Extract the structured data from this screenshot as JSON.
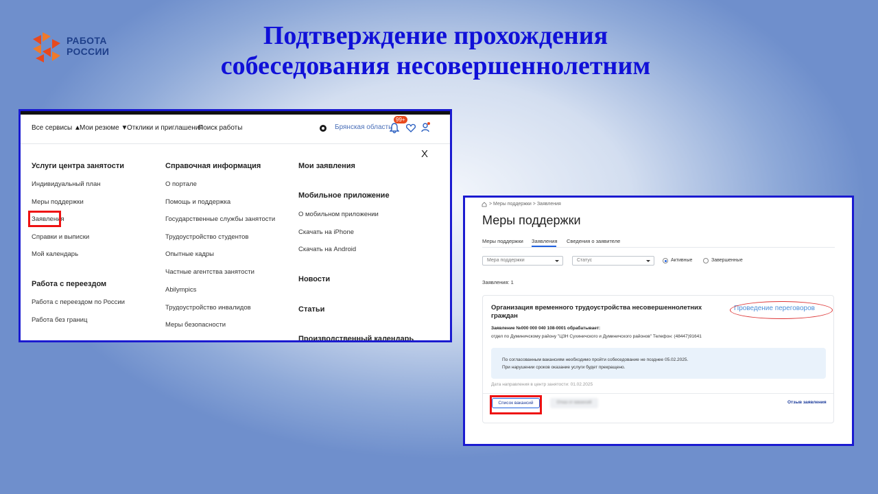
{
  "logo": {
    "line1": "РАБОТА",
    "line2": "РОССИИ",
    "colors": [
      "#e8491d",
      "#f07a2a"
    ]
  },
  "slide_title": {
    "line1": "Подтверждение прохождения",
    "line2": "собеседования несовершеннолетним"
  },
  "left_screen": {
    "nav": {
      "all_services": "Все сервисы ▲",
      "my_resume": "Мои резюме ▼",
      "responses": "Отклики и приглашения",
      "job_search": "Поиск работы",
      "region": "Брянская область",
      "notifications_badge": "99+"
    },
    "close": "X",
    "col1": {
      "heading1": "Услуги центра занятости",
      "items1": [
        "Индивидуальный план",
        "Меры поддержки",
        "Заявления",
        "Справки и выписки",
        "Мой календарь"
      ],
      "heading2": "Работа с переездом",
      "items2": [
        "Работа с переездом по России",
        "Работа без границ"
      ]
    },
    "col2": {
      "heading": "Справочная информация",
      "items": [
        "О портале",
        "Помощь и поддержка",
        "Государственные службы занятости",
        "Трудоустройство студентов",
        "Опытные кадры",
        "Частные агентства занятости",
        "Abilympics",
        "Трудоустройство инвалидов",
        "Меры безопасности"
      ]
    },
    "col3": {
      "heading1": "Мои заявления",
      "heading2": "Мобильное приложение",
      "items2": [
        "О мобильном приложении",
        "Скачать на iPhone",
        "Скачать на Android"
      ],
      "heading3": "Новости",
      "heading4": "Статьи",
      "heading5": "Производственный календарь"
    },
    "highlight_color": "#e11111"
  },
  "right_screen": {
    "breadcrumbs": "> Меры поддержки > Заявления",
    "title": "Меры поддержки",
    "tabs": [
      "Меры поддержки",
      "Заявления",
      "Сведения о заявителе"
    ],
    "active_tab": "Заявления",
    "filters": {
      "support_placeholder": "Мера поддержки",
      "status_placeholder": "Статус",
      "radio_active": "Активные",
      "radio_completed": "Завершенные"
    },
    "count": "Заявления: 1",
    "card": {
      "title": "Организация временного трудоустройства несовершеннолетних граждан",
      "status": "Проведение переговоров",
      "application": "Заявление №000 000 040 108-0001 обрабатывает:",
      "organization": "отдел по Думиничскому району \"ЦЗН Сухиничского и Думиничского районов\" Телефон: (48447)91641",
      "notice_line1": "По согласованным вакансиям необходимо пройти собеседование не позднее 05.02.2025.",
      "notice_line2": "При нарушении сроков оказание услуги будет прекращено.",
      "date_sent": "Дата направления в центр занятости: 01.02.2025",
      "button_vacancies": "Список вакансий",
      "button_blurred": "Отказ от вакансий",
      "withdraw": "Отзыв заявления"
    },
    "accent_color": "#1d5fe0"
  }
}
